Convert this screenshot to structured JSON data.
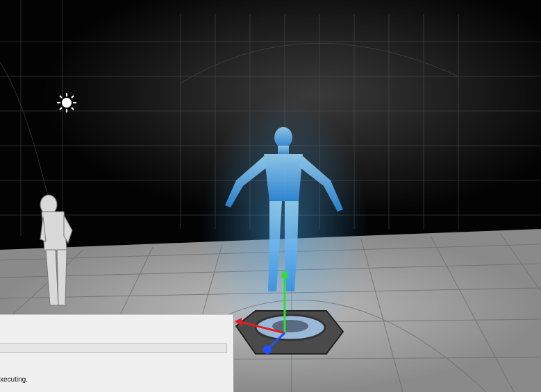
{
  "viewport": {
    "scene": "3d-level-viewport",
    "icons": {
      "light": "directional-light-icon",
      "gizmo": "translate-gizmo-icon"
    },
    "colors": {
      "hologram": "#4fb6ff",
      "gizmo_x": "#e02020",
      "gizmo_y": "#30e030",
      "gizmo_z": "#2050ff"
    }
  },
  "progress_dialog": {
    "progress": 0,
    "status_text": "xecuting."
  }
}
